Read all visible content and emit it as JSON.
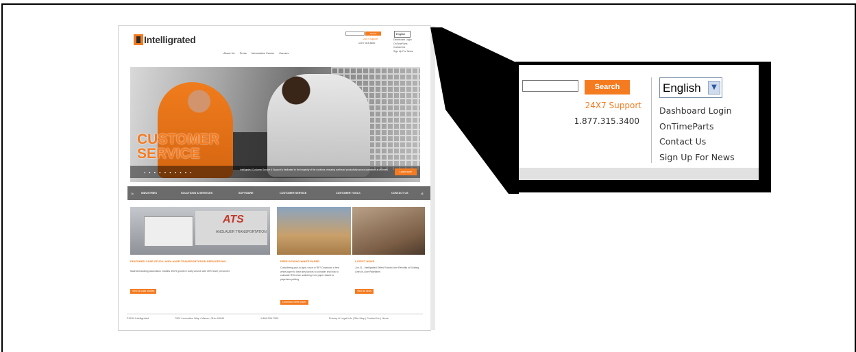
{
  "site": {
    "logo_text": "Intelligrated",
    "topnav": [
      "About Us",
      "Press",
      "Information Center",
      "Careers"
    ],
    "search_button": "Search",
    "support": "24X7 Support",
    "phone": "1.877.315.3400",
    "language": "English",
    "links": [
      "Dashboard Login",
      "OnTimeParts",
      "Contact Us",
      "Sign Up For News"
    ],
    "hero_title_line1": "CUSTOMER",
    "hero_title_line2": "SERVICE",
    "hero_dots": "◂ ● ● ● ● ● ● ● ● ▸",
    "hero_caption": "Intelligrated Customer Service & Support is dedicated to the longevity of the solutions, ensuring continued productivity across operations at all levels.",
    "hero_button": "Learn more",
    "mainnav": [
      "INDUSTRIES",
      "SOLUTIONS & SERVICES",
      "SOFTWARE",
      "CUSTOMER SERVICE",
      "CUSTOMER TOOLS",
      "CONTACT US"
    ],
    "thumb1_logo": "ATS",
    "thumb1_trailer": "ANDLAUER TRANSPORTATION",
    "sections": [
      {
        "title": "FEATURED CASE STUDY: ANDLAUER TRANSPORTATION SERVICES INC.",
        "body": "Material handling automation enables 300% growth in daily volume with 30% fewer personnel.",
        "button": "View all case studies"
      },
      {
        "title": "FREE PICKING WHITE PAPER",
        "body": "Considering pick-to-light, voice or RF? Download a free white paper to learn key factors to consider and how to calculate ROI when switching from paper-based to paperless picking.",
        "button": "Download white paper"
      },
      {
        "title": "LATEST NEWS",
        "body": "Jun 21 - Intelligrated Offers Robotic Arm Retrofits to Existing Lines In-Line Palletizers",
        "button": "View all news"
      }
    ],
    "footer": {
      "copyright": "©2010 Intelligrated",
      "address": "7901 Innovation Way • Mason, Ohio 45040",
      "phone": "1.866.936.7300",
      "links": "Privacy & Legal Info  |  Site Map  |  Contact Us  |  Home"
    }
  },
  "callout": {
    "search_button": "Search",
    "search_value": "",
    "support": "24X7 Support",
    "phone": "1.877.315.3400",
    "language": "English",
    "links": [
      "Dashboard Login",
      "OnTimeParts",
      "Contact Us",
      "Sign Up For News"
    ]
  },
  "colors": {
    "accent": "#f47b20",
    "nav": "#6b6b6b",
    "text": "#333333"
  }
}
